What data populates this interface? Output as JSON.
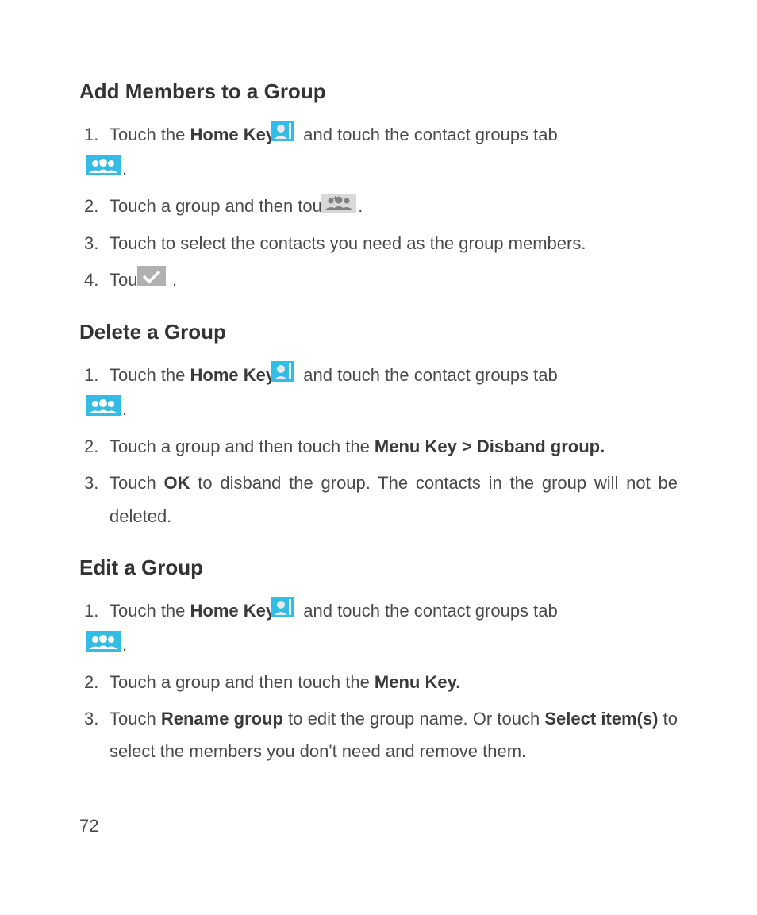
{
  "page_number": "72",
  "sections": [
    {
      "heading": "Add Members to a Group",
      "items": [
        {
          "num": "1.",
          "pre": "Touch the ",
          "bold1": "Home Key > ",
          "mid1": " and touch the contact groups tab ",
          "end": "."
        },
        {
          "num": "2.",
          "pre": "Touch a group and then touch ",
          "end": "."
        },
        {
          "num": "3.",
          "text": "Touch to select the contacts you need as the group members."
        },
        {
          "num": "4.",
          "pre": "Touch ",
          "end": " ."
        }
      ]
    },
    {
      "heading": "Delete a Group",
      "items": [
        {
          "num": "1.",
          "pre": "Touch the ",
          "bold1": "Home Key > ",
          "mid1": "  and touch the contact groups tab ",
          "end": "."
        },
        {
          "num": "2.",
          "pre": "Touch a group and then touch the ",
          "bold1": "Menu Key > Disband group."
        },
        {
          "num": "3.",
          "pre": "Touch ",
          "bold1": "OK",
          "mid1": " to disband the group. The contacts in the group will not be deleted."
        }
      ]
    },
    {
      "heading": "Edit a Group",
      "items": [
        {
          "num": "1.",
          "pre": "Touch the ",
          "bold1": "Home Key > ",
          "mid1": " and touch the contact groups tab ",
          "end": "."
        },
        {
          "num": "2.",
          "pre": "Touch a group and then touch the ",
          "bold1": "Menu Key."
        },
        {
          "num": "3.",
          "pre": "Touch ",
          "bold1": "Rename group",
          "mid1": " to edit the group name. Or touch ",
          "bold2": "Select item(s)",
          "mid2": " to select the members you don't need and remove them."
        }
      ]
    }
  ]
}
